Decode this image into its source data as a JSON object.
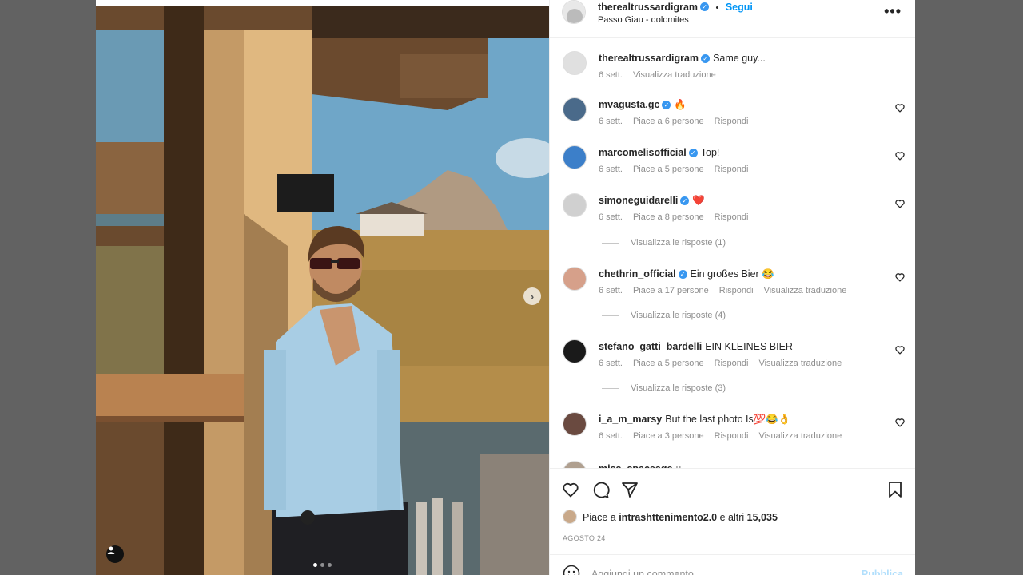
{
  "post": {
    "author": "therealtrussardigram",
    "follow_label": "Segui",
    "separator": "•",
    "location": "Passo Giau - dolomites",
    "more": "•••"
  },
  "comments": [
    {
      "user": "therealtrussardigram",
      "verified": true,
      "text": "Same guy...",
      "time": "6 sett.",
      "likes": "",
      "reply": "",
      "translate": "Visualizza traduzione",
      "heart": false,
      "view_replies": ""
    },
    {
      "user": "mvagusta.gc",
      "verified": true,
      "text": "🔥",
      "time": "6 sett.",
      "likes": "Piace a 6 persone",
      "reply": "Rispondi",
      "translate": "",
      "heart": true,
      "view_replies": ""
    },
    {
      "user": "marcomelisofficial",
      "verified": true,
      "text": "Top!",
      "time": "6 sett.",
      "likes": "Piace a 5 persone",
      "reply": "Rispondi",
      "translate": "",
      "heart": true,
      "view_replies": ""
    },
    {
      "user": "simoneguidarelli",
      "verified": true,
      "text": "❤️",
      "time": "6 sett.",
      "likes": "Piace a 8 persone",
      "reply": "Rispondi",
      "translate": "",
      "heart": true,
      "view_replies": "Visualizza le risposte (1)"
    },
    {
      "user": "chethrin_official",
      "verified": true,
      "text": "Ein großes Bier 😂",
      "time": "6 sett.",
      "likes": "Piace a 17 persone",
      "reply": "Rispondi",
      "translate": "Visualizza traduzione",
      "heart": true,
      "view_replies": "Visualizza le risposte (4)"
    },
    {
      "user": "stefano_gatti_bardelli",
      "verified": false,
      "text": "EIN KLEINES BIER",
      "time": "6 sett.",
      "likes": "Piace a 5 persone",
      "reply": "Rispondi",
      "translate": "Visualizza traduzione",
      "heart": true,
      "view_replies": "Visualizza le risposte (3)"
    },
    {
      "user": "i_a_m_marsy",
      "verified": false,
      "text": "But the last photo Is💯😂👌",
      "time": "6 sett.",
      "likes": "Piace a 3 persone",
      "reply": "Rispondi",
      "translate": "Visualizza traduzione",
      "heart": true,
      "view_replies": ""
    },
    {
      "user": "miss_spaceage",
      "verified": false,
      "text": "▯",
      "time": "",
      "likes": "",
      "reply": "",
      "translate": "",
      "heart": false,
      "view_replies": ""
    }
  ],
  "likes": {
    "prefix": "Piace a",
    "user": "intrashttenimento2.0",
    "middle": "e altri",
    "count": "15,035"
  },
  "date": "AGOSTO 24",
  "add_comment": {
    "placeholder": "Aggiungi un commento...",
    "publish": "Pubblica"
  },
  "icons": [
    "heart-icon",
    "comment-icon",
    "share-icon",
    "save-icon",
    "emoji-icon",
    "chevron-right-icon",
    "user-tag-icon"
  ],
  "carousel": {
    "count": 3,
    "active": 1
  },
  "colors": {
    "accent": "#0095f6",
    "verified": "#3897f0",
    "muted": "#8e8e8e",
    "backdrop": "#626262"
  }
}
